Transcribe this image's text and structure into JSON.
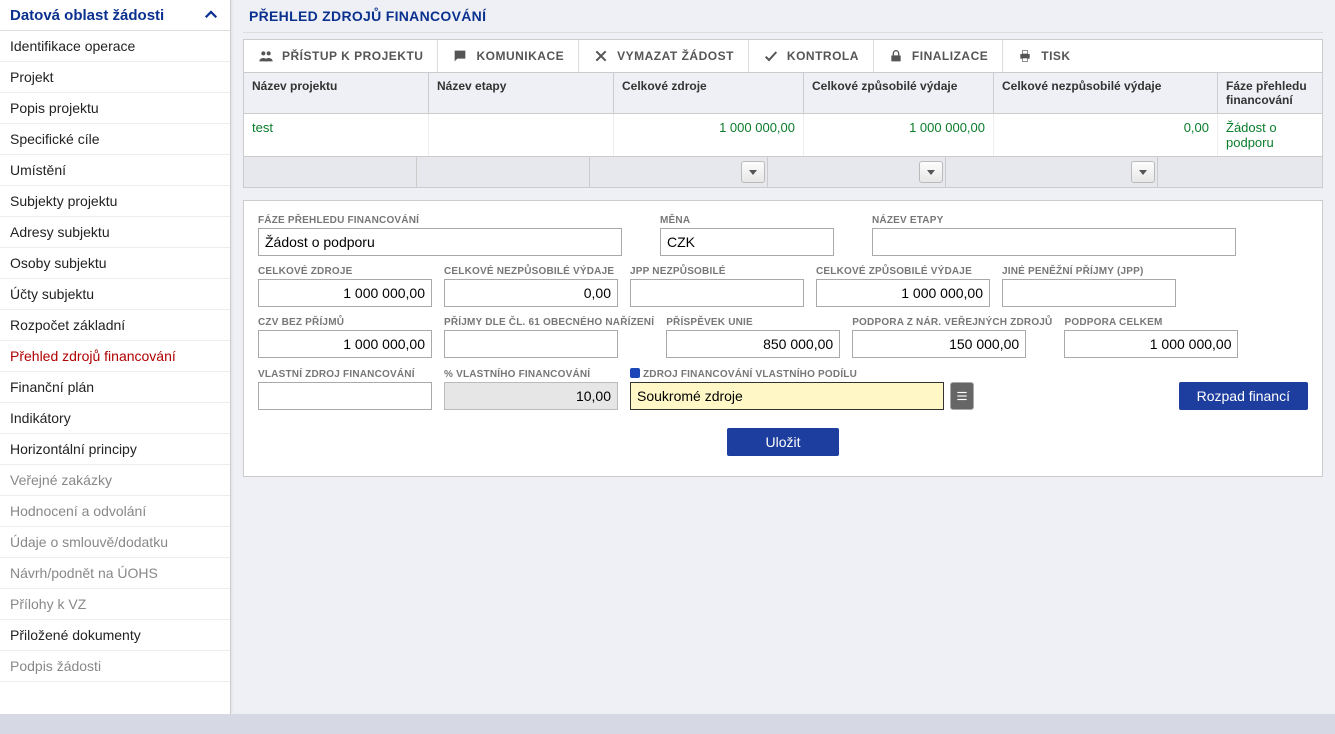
{
  "sidebar": {
    "title": "Datová oblast žádosti",
    "items": [
      {
        "label": "Identifikace operace"
      },
      {
        "label": "Projekt"
      },
      {
        "label": "Popis projektu"
      },
      {
        "label": "Specifické cíle"
      },
      {
        "label": "Umístění"
      },
      {
        "label": "Subjekty projektu"
      },
      {
        "label": "Adresy subjektu"
      },
      {
        "label": "Osoby subjektu"
      },
      {
        "label": "Účty subjektu"
      },
      {
        "label": "Rozpočet základní"
      },
      {
        "label": "Přehled zdrojů financování",
        "active": true
      },
      {
        "label": "Finanční plán"
      },
      {
        "label": "Indikátory"
      },
      {
        "label": "Horizontální principy"
      },
      {
        "label": "Veřejné zakázky",
        "muted": true
      },
      {
        "label": "Hodnocení a odvolání",
        "muted": true
      },
      {
        "label": "Údaje o smlouvě/dodatku",
        "muted": true
      },
      {
        "label": "Návrh/podnět na ÚOHS",
        "muted": true
      },
      {
        "label": "Přílohy k VZ",
        "muted": true
      },
      {
        "label": "Přiložené dokumenty"
      },
      {
        "label": "Podpis žádosti",
        "muted": true
      }
    ]
  },
  "page": {
    "title": "PŘEHLED ZDROJŮ FINANCOVÁNÍ"
  },
  "toolbar": {
    "access": "PŘÍSTUP K PROJEKTU",
    "comm": "KOMUNIKACE",
    "delete": "VYMAZAT ŽÁDOST",
    "check": "KONTROLA",
    "finalize": "FINALIZACE",
    "print": "TISK"
  },
  "grid": {
    "headers": {
      "proj": "Název projektu",
      "stage": "Název etapy",
      "total": "Celkové zdroje",
      "eligible": "Celkové způsobilé výdaje",
      "ineligible": "Celkové nezpůsobilé výdaje",
      "phase": "Fáze přehledu financování"
    },
    "row": {
      "proj": "test",
      "stage": "",
      "total": "1 000 000,00",
      "eligible": "1 000 000,00",
      "ineligible": "0,00",
      "phase": "Žádost o podporu"
    }
  },
  "form": {
    "phase_label": "FÁZE PŘEHLEDU FINANCOVÁNÍ",
    "phase": "Žádost o podporu",
    "currency_label": "MĚNA",
    "currency": "CZK",
    "stage_label": "NÁZEV ETAPY",
    "stage": "",
    "total_label": "CELKOVÉ ZDROJE",
    "total": "1 000 000,00",
    "ineligible_label": "CELKOVÉ NEZPŮSOBILÉ VÝDAJE",
    "ineligible": "0,00",
    "jpp_in_label": "JPP NEZPŮSOBILÉ",
    "jpp_in": "",
    "eligible_label": "CELKOVÉ ZPŮSOBILÉ VÝDAJE",
    "eligible": "1 000 000,00",
    "other_income_label": "JINÉ PENĚŽNÍ PŘÍJMY (JPP)",
    "other_income": "",
    "czv_label": "CZV BEZ PŘÍJMŮ",
    "czv": "1 000 000,00",
    "art61_label": "PŘÍJMY DLE ČL. 61 OBECNÉHO NAŘÍZENÍ",
    "art61": "",
    "eu_label": "PŘÍSPĚVEK UNIE",
    "eu": "850 000,00",
    "natpub_label": "PODPORA Z NÁR. VEŘEJNÝCH ZDROJŮ",
    "natpub": "150 000,00",
    "support_total_label": "PODPORA CELKEM",
    "support_total": "1 000 000,00",
    "own_src_label": "VLASTNÍ ZDROJ FINANCOVÁNÍ",
    "own_src": "",
    "own_pct_label": "% VLASTNÍHO FINANCOVÁNÍ",
    "own_pct": "10,00",
    "own_type_label": "ZDROJ FINANCOVÁNÍ VLASTNÍHO PODÍLU",
    "own_type": "Soukromé zdroje",
    "breakdown_btn": "Rozpad financí",
    "save_btn": "Uložit"
  }
}
